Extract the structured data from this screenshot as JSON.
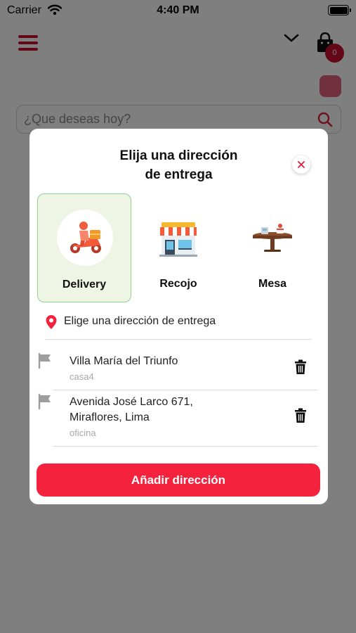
{
  "status_bar": {
    "carrier": "Carrier",
    "time": "4:40 PM"
  },
  "header": {
    "cart_count": "0"
  },
  "search": {
    "placeholder": "¿Que deseas hoy?"
  },
  "modal": {
    "title_line1": "Elija una dirección",
    "title_line2": "de entrega",
    "delivery_options": [
      {
        "label": "Delivery",
        "icon": "scooter-delivery-icon",
        "selected": true
      },
      {
        "label": "Recojo",
        "icon": "store-icon",
        "selected": false
      },
      {
        "label": "Mesa",
        "icon": "table-icon",
        "selected": false
      }
    ],
    "choose_address_label": "Elige una dirección de entrega",
    "addresses": [
      {
        "line1": "Villa María del Triunfo",
        "line2": "",
        "tag": "casa4"
      },
      {
        "line1": "Avenida José Larco 671,",
        "line2": "Miraflores, Lima",
        "tag": "oficina"
      }
    ],
    "add_button_label": "Añadir dirección"
  },
  "colors": {
    "brand_red": "#f5223d",
    "menu_red": "#c8102e",
    "selected_bg": "#eef5e4",
    "selected_border": "#8fd08a",
    "icon_gray": "#9e9e9e"
  }
}
